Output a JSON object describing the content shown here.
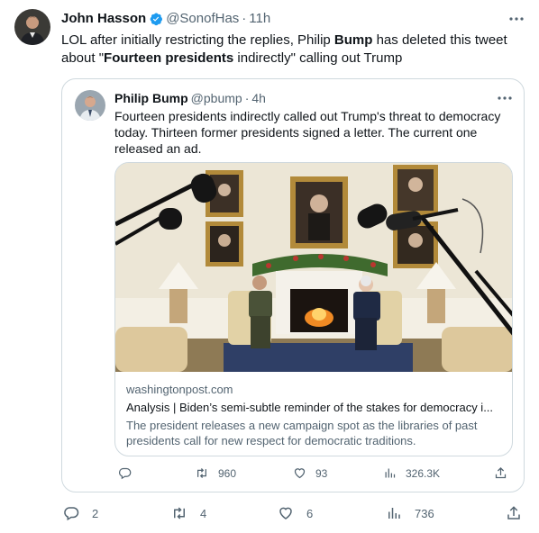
{
  "tweet": {
    "author_name": "John Hasson",
    "handle": "@SonofHas",
    "separator": "·",
    "time": "11h",
    "text_parts": {
      "p1": "LOL after initially restricting the replies, Philip ",
      "bold1": "Bump",
      "p2": " has deleted this tweet about \"",
      "bold2": "Fourteen presidents",
      "p3": " indirectly\" calling out Trump"
    },
    "stats": {
      "replies": "2",
      "retweets": "4",
      "likes": "6",
      "views": "736"
    }
  },
  "quote": {
    "author_name": "Philip Bump",
    "handle": "@pbump",
    "separator": "·",
    "time": "4h",
    "text": "Fourteen presidents indirectly called out Trump's threat to democracy today. Thirteen former presidents signed a letter. The current one released an ad.",
    "card": {
      "domain": "washingtonpost.com",
      "title": "Analysis | Biden’s semi-subtle reminder of the stakes for democracy i...",
      "description": "The president releases a new campaign spot as the libraries of past presidents call for new respect for democratic traditions."
    },
    "stats": {
      "replies": "",
      "retweets": "960",
      "likes": "93",
      "views": "326.3K"
    }
  },
  "colors": {
    "text": "#0f1419",
    "secondary": "#536471",
    "border": "#cfd9de",
    "verified": "#1d9bf0"
  },
  "icons": [
    "verified-badge-icon",
    "more-icon",
    "reply-icon",
    "retweet-icon",
    "like-icon",
    "views-icon",
    "share-icon"
  ]
}
